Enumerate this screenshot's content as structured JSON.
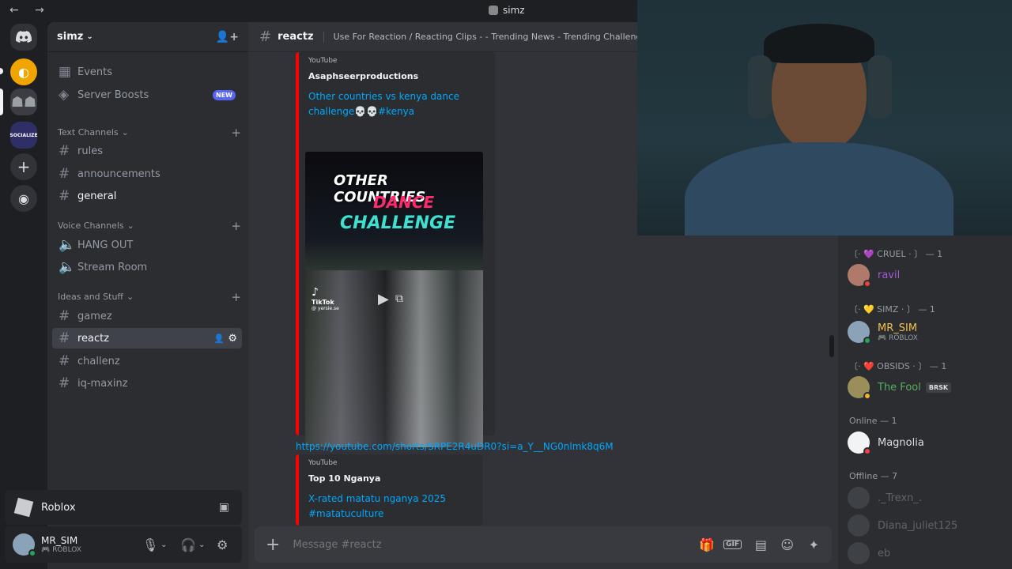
{
  "window": {
    "title": "simz",
    "nav": "← →"
  },
  "server": {
    "name": "simz"
  },
  "sidebar": {
    "events": "Events",
    "boosts": "Server Boosts",
    "boosts_badge": "NEW",
    "categories": {
      "text": "Text Channels",
      "voice": "Voice Channels",
      "ideas": "Ideas and Stuff"
    },
    "text_channels": [
      "rules",
      "announcements",
      "general"
    ],
    "voice_channels": [
      "HANG OUT",
      "Stream Room"
    ],
    "ideas_channels": [
      "gamez",
      "reactz",
      "challenz",
      "iq-maxinz"
    ]
  },
  "activity": {
    "name": "Roblox"
  },
  "user": {
    "name": "MR_SIM",
    "status": "ROBLOX"
  },
  "channel": {
    "name": "reactz",
    "topic": "Use For Reaction / Reacting Clips - - Trending News - Trending Challenges - Vira"
  },
  "messages": {
    "embed1": {
      "provider": "YouTube",
      "author": "Asaphseerproductions",
      "title": "Other countries vs kenya dance challenge💀💀#kenya",
      "thumb_text": [
        "OTHER COUNTRIES",
        "DANCE",
        "CHALLENGE"
      ],
      "tiktok": "TikTok",
      "tiktok_handle": "@ yersie.se"
    },
    "link": "https://youtube.com/shorts/SRPE2R4uDR0?si=a_Y__NG0nlmk8q6M",
    "embed2": {
      "provider": "YouTube",
      "author": "Top 10 Nganya",
      "title_line1": "X-rated matatu nganya 2025",
      "title_line2": "#matatuculture"
    }
  },
  "composer": {
    "placeholder": "Message #reactz"
  },
  "members": {
    "groups": [
      {
        "label": "〔· 💜 CRUEL · 〕 — 1",
        "members": [
          {
            "name": "ravil",
            "color": "#a45ad8"
          }
        ]
      },
      {
        "label": "〔· 💛 SIMZ · 〕 — 1",
        "members": [
          {
            "name": "MR_SIM",
            "color": "#f0c14b",
            "sub": "ROBLOX"
          }
        ]
      },
      {
        "label": "〔· ❤️ OBSIDS · 〕 — 1",
        "members": [
          {
            "name": "The Fool",
            "color": "#57b05f",
            "tag": "BRSK"
          }
        ]
      }
    ],
    "online_label": "Online — 1",
    "online": [
      "Magnolia"
    ],
    "offline_label": "Offline — 7",
    "offline": [
      "._Trexn_.",
      "Diana_juliet125",
      "eb"
    ]
  },
  "colors": {
    "accent": "#5865f2",
    "link": "#00a8fc",
    "youtube": "#ff0000"
  }
}
